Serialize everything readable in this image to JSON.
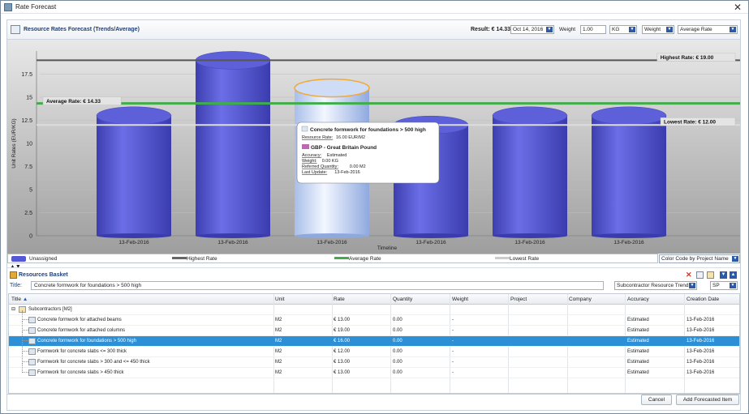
{
  "window": {
    "title": "Rate Forecast",
    "close_glyph": "✕"
  },
  "header": {
    "title": "Resource Rates Forecast (Trends/Average)",
    "result_label": "Result: € 14.33",
    "date_value": "Oct 14, 2016",
    "weight_label": "Weight",
    "weight_value": "1.00",
    "unit_value": "KG",
    "weight_select": "Weight",
    "mode_select": "Average Rate"
  },
  "chart_data": {
    "type": "bar",
    "categories": [
      "13-Feb-2016",
      "13-Feb-2016",
      "13-Feb-2016",
      "13-Feb-2016",
      "13-Feb-2016",
      "13-Feb-2016"
    ],
    "values": [
      13.0,
      19.0,
      16.0,
      12.0,
      13.0,
      13.0
    ],
    "xlabel": "Timeline",
    "ylabel": "Unit Rates (EUR/KG)",
    "ylim": [
      0,
      20
    ],
    "yticks": [
      0,
      2.5,
      5,
      7.5,
      10,
      12.5,
      15,
      17.5
    ],
    "ytick_labels": [
      "0",
      "2.5",
      "5",
      "7.5",
      "10",
      "12.5",
      "15",
      "17.5"
    ],
    "highlighted_index": 2,
    "lines": [
      {
        "name": "Highest Rate",
        "value": 19.0,
        "label": "Highest Rate: € 19.00",
        "color": "#555555"
      },
      {
        "name": "Average Rate",
        "value": 14.33,
        "label": "Average Rate: € 14.33",
        "color": "#3fae49"
      },
      {
        "name": "Lowest Rate",
        "value": 12.0,
        "label": "Lowest Rate: € 12.00",
        "color": "#dddddd"
      }
    ],
    "bar_color": "#5558d6",
    "grid": true
  },
  "tooltip": {
    "title": "Concrete formwork for foundations > 500 high",
    "resource_rate_label": "Resource Rate:",
    "resource_rate_value": "16.00 EUR/M2",
    "currency": "GBP - Great Britain Pound",
    "accuracy_label": "Accuracy:",
    "accuracy_value": "Estimated",
    "weight_label": "Weight:",
    "weight_value": "0.00 KG",
    "refqty_label": "Referred Quantity:",
    "refqty_value": "0.00 M2",
    "lastupdate_label": "Last Update:",
    "lastupdate_value": "13-Feb-2016"
  },
  "legend": {
    "items": [
      "Unassigned",
      "Highest Rate",
      "Average Rate",
      "Lowest Rate"
    ],
    "color_code_select": "Color Code by Project Name"
  },
  "basket": {
    "title": "Resources Basket",
    "title_label": "Title:",
    "title_value": "Concrete formwork for foundations > 500 high",
    "trend_select": "Subcontractor Resource Trend",
    "sp_select": "SP"
  },
  "grid": {
    "columns": [
      "Title",
      "Unit",
      "Rate",
      "Quantity",
      "Weight",
      "Project",
      "Company",
      "Accuracy",
      "Creation Date"
    ],
    "group": "Subcontractors [M2]",
    "rows": [
      {
        "title": "Concrete formwork for attached beams",
        "unit": "M2",
        "rate": "€ 13.00",
        "quantity": "0.00",
        "weight": "-",
        "project": "",
        "company": "",
        "accuracy": "Estimated",
        "date": "13-Feb-2016"
      },
      {
        "title": "Concrete formwork for attached columns",
        "unit": "M2",
        "rate": "€ 19.00",
        "quantity": "0.00",
        "weight": "-",
        "project": "",
        "company": "",
        "accuracy": "Estimated",
        "date": "13-Feb-2016"
      },
      {
        "title": "Concrete formwork for foundations > 500 high",
        "unit": "M2",
        "rate": "€ 16.00",
        "quantity": "0.00",
        "weight": "-",
        "project": "",
        "company": "",
        "accuracy": "Estimated",
        "date": "13-Feb-2016"
      },
      {
        "title": "Formwork for concrete slabs <= 300 thick",
        "unit": "M2",
        "rate": "€ 12.00",
        "quantity": "0.00",
        "weight": "-",
        "project": "",
        "company": "",
        "accuracy": "Estimated",
        "date": "13-Feb-2016"
      },
      {
        "title": "Formwork for concrete slabs > 300 and <= 450 thick",
        "unit": "M2",
        "rate": "€ 13.00",
        "quantity": "0.00",
        "weight": "-",
        "project": "",
        "company": "",
        "accuracy": "Estimated",
        "date": "13-Feb-2016"
      },
      {
        "title": "Formwork for concrete slabs > 450 thick",
        "unit": "M2",
        "rate": "€ 13.00",
        "quantity": "0.00",
        "weight": "-",
        "project": "",
        "company": "",
        "accuracy": "Estimated",
        "date": "13-Feb-2016"
      }
    ]
  },
  "buttons": {
    "cancel": "Cancel",
    "add": "Add Forecasted Item"
  },
  "colors": {
    "selection": "#2d8fd6",
    "accent": "#1f3f75"
  }
}
